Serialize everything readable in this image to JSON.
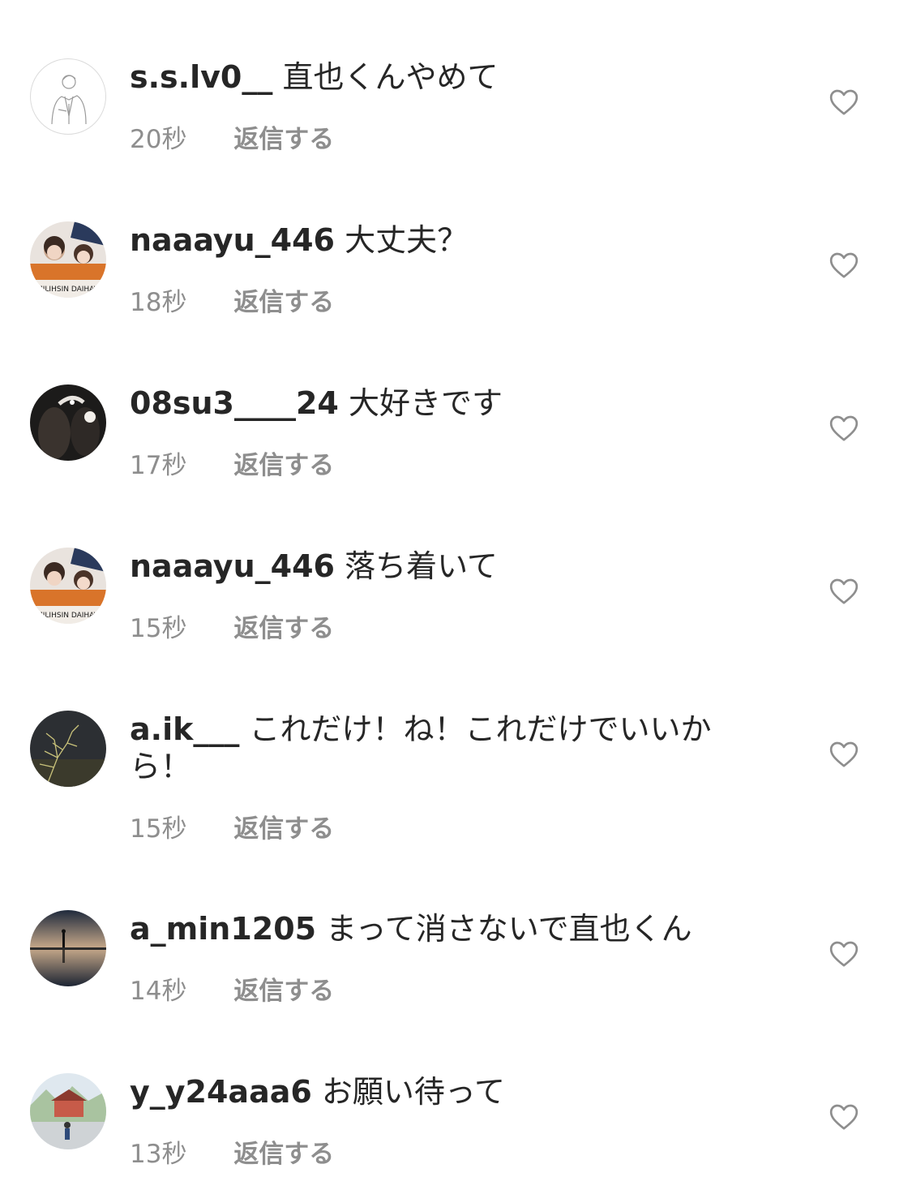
{
  "comments": [
    {
      "username": "s.s.lv0__",
      "text": "直也くんやめて",
      "time": "20秒",
      "reply": "返信する",
      "avatar_icon": "sketch-person-avatar"
    },
    {
      "username": "naaayu_446",
      "text": "大丈夫？",
      "time": "18秒",
      "reply": "返信する",
      "avatar_icon": "photo-avatar"
    },
    {
      "username": "08su3____24",
      "text": "大好きです",
      "time": "17秒",
      "reply": "返信する",
      "avatar_icon": "photo-avatar"
    },
    {
      "username": "naaayu_446",
      "text": "落ち着いて",
      "time": "15秒",
      "reply": "返信する",
      "avatar_icon": "photo-avatar"
    },
    {
      "username": "a.ik___",
      "text": "これだけ！ね！これだけでいいから！",
      "time": "15秒",
      "reply": "返信する",
      "avatar_icon": "photo-avatar"
    },
    {
      "username": "a_min1205",
      "text": "まって消さないで直也くん",
      "time": "14秒",
      "reply": "返信する",
      "avatar_icon": "photo-avatar"
    },
    {
      "username": "y_y24aaa6",
      "text": "お願い待って",
      "time": "13秒",
      "reply": "返信する",
      "avatar_icon": "photo-avatar"
    }
  ],
  "icons": {
    "like": "heart-outline-icon"
  },
  "colors": {
    "text": "#262626",
    "meta": "#8e8e8e",
    "background": "#ffffff"
  }
}
